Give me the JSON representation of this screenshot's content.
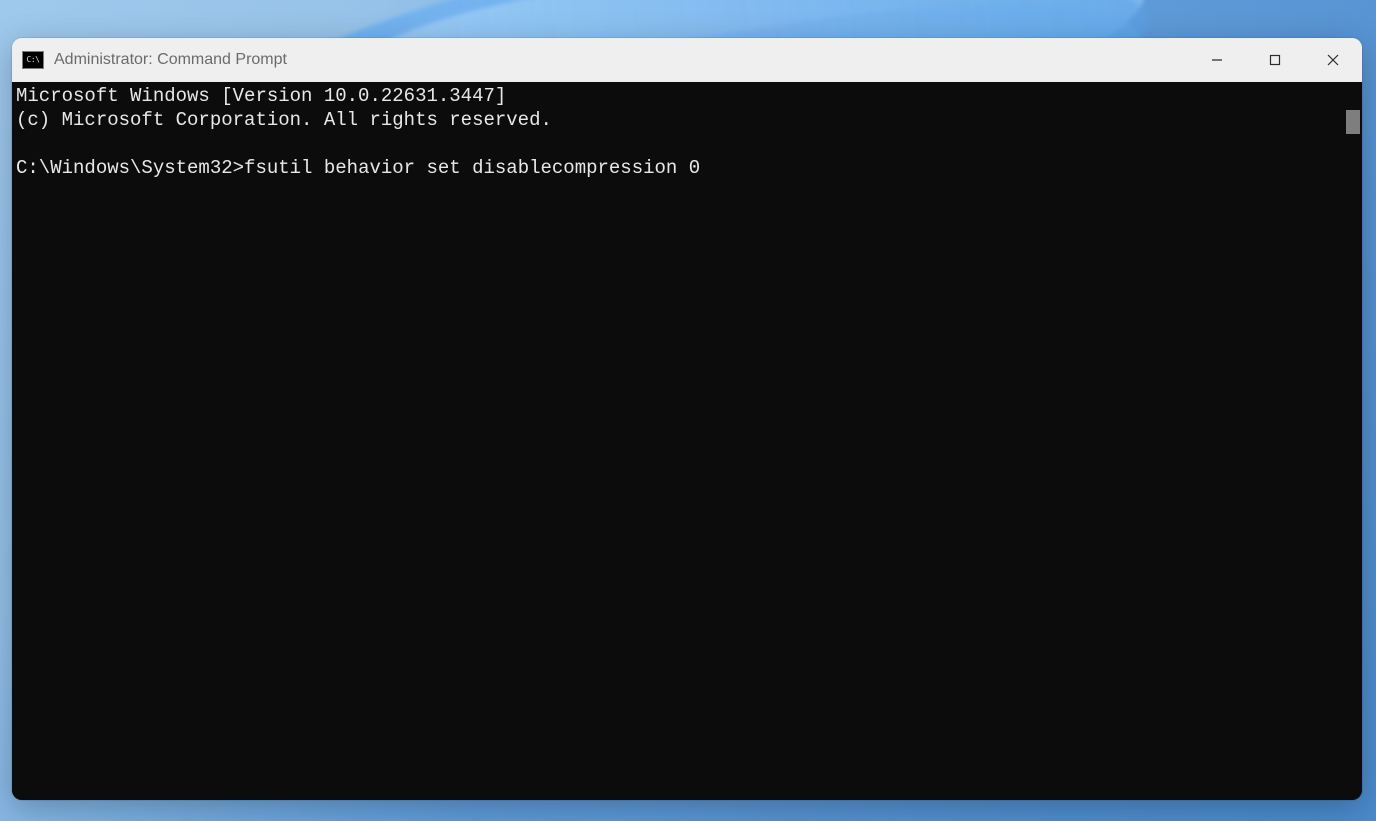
{
  "window": {
    "title": "Administrator: Command Prompt"
  },
  "console": {
    "line1": "Microsoft Windows [Version 10.0.22631.3447]",
    "line2": "(c) Microsoft Corporation. All rights reserved.",
    "blank": "",
    "prompt_path": "C:\\Windows\\System32>",
    "command": "fsutil behavior set disablecompression 0"
  }
}
